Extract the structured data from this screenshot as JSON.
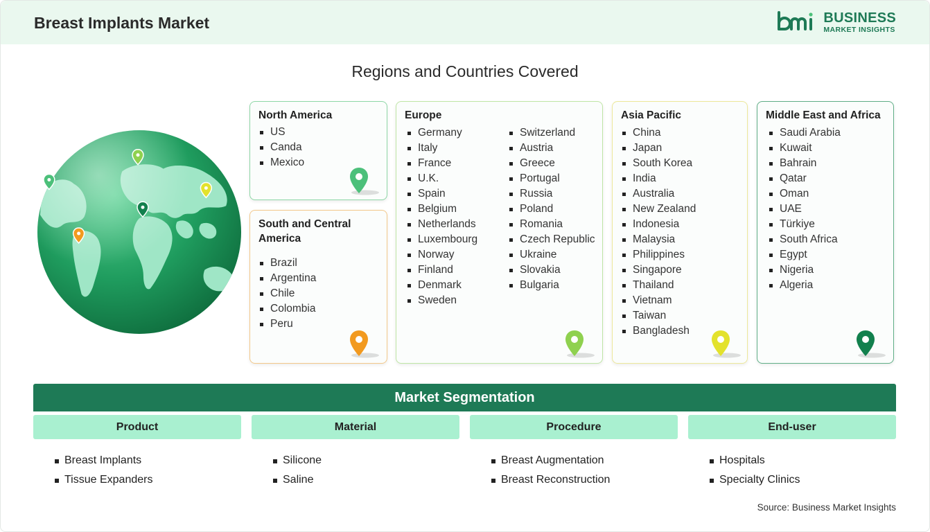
{
  "header": {
    "title": "Breast Implants Market",
    "logo_line1": "BUSINESS",
    "logo_line2": "MARKET INSIGHTS",
    "logo_mark": "bmi"
  },
  "regions_title": "Regions and Countries Covered",
  "regions": [
    {
      "name": "North America",
      "countries": [
        "US",
        "Canda",
        "Mexico"
      ],
      "pin_color": "#4cc07a"
    },
    {
      "name": "South and Central America",
      "countries": [
        "Brazil",
        "Argentina",
        "Chile",
        "Colombia",
        "Peru"
      ],
      "pin_color": "#f29a1f"
    },
    {
      "name": "Europe",
      "countries": [
        "Germany",
        "Italy",
        "France",
        "U.K.",
        "Spain",
        "Belgium",
        "Netherlands",
        "Luxembourg",
        "Norway",
        "Finland",
        "Denmark",
        "Sweden",
        "Switzerland",
        "Austria",
        "Greece",
        "Portugal",
        "Russia",
        "Poland",
        "Romania",
        "Czech Republic",
        "Ukraine",
        "Slovakia",
        "Bulgaria"
      ],
      "pin_color": "#8fd14f"
    },
    {
      "name": "Asia Pacific",
      "countries": [
        "China",
        "Japan",
        "South Korea",
        "India",
        "Australia",
        "New Zealand",
        "Indonesia",
        "Malaysia",
        "Philippines",
        "Singapore",
        "Thailand",
        "Vietnam",
        "Taiwan",
        "Bangladesh"
      ],
      "pin_color": "#e3e22c"
    },
    {
      "name": "Middle East and Africa",
      "countries": [
        "Saudi Arabia",
        "Kuwait",
        "Bahrain",
        "Qatar",
        "Oman",
        "UAE",
        "Türkiye",
        "South Africa",
        "Egypt",
        "Nigeria",
        "Algeria"
      ],
      "pin_color": "#12804d"
    }
  ],
  "segmentation": {
    "title": "Market Segmentation",
    "columns": [
      {
        "heading": "Product",
        "items": [
          "Breast Implants",
          "Tissue Expanders"
        ]
      },
      {
        "heading": "Material",
        "items": [
          "Silicone",
          "Saline"
        ]
      },
      {
        "heading": "Procedure",
        "items": [
          "Breast Augmentation",
          "Breast Reconstruction"
        ]
      },
      {
        "heading": "End-user",
        "items": [
          "Hospitals",
          "Specialty Clinics"
        ]
      }
    ]
  },
  "source": "Source: Business Market Insights",
  "colors": {
    "brand_green": "#1e7a56",
    "segment_header": "#a9f0d0",
    "header_bg": "#eaf8ef"
  },
  "icons": [
    "globe-icon",
    "location-pin-icon",
    "bmi-logo-icon"
  ]
}
